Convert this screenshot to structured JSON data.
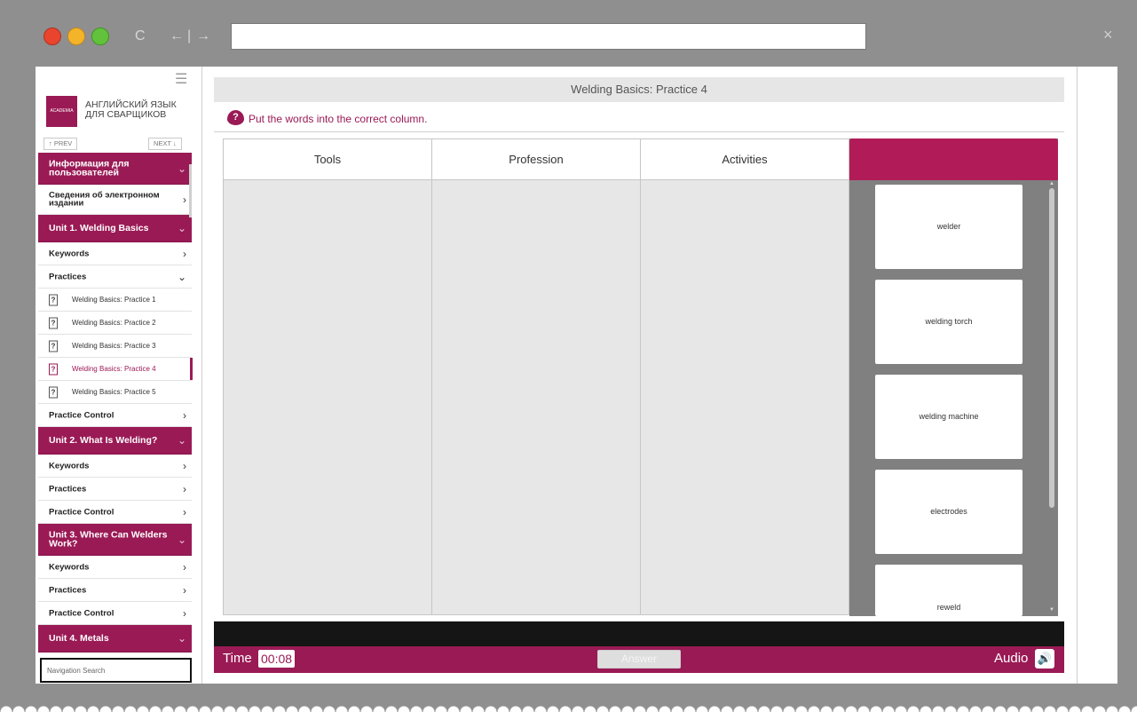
{
  "browser": {
    "refresh_icon": "C",
    "back_icon": "←",
    "forward_icon": "→",
    "divider": "|",
    "url": "",
    "close_icon": "×"
  },
  "sidebar": {
    "menu_icon": "☰",
    "logo_text": "ACADEMIA",
    "brand_line1": "АНГЛИЙСКИЙ ЯЗЫК",
    "brand_line2": "ДЛЯ СВАРЩИКОВ",
    "prev_label": "↑ PREV",
    "next_label": "NEXT ↓",
    "items": [
      {
        "type": "unit",
        "label": "Информация для пользователей",
        "chevron": "⌄"
      },
      {
        "type": "item",
        "label": "Сведения об электронном издании",
        "chevron": "›"
      },
      {
        "type": "unit",
        "label": "Unit 1. Welding Basics",
        "chevron": "⌄"
      },
      {
        "type": "item",
        "label": "Keywords",
        "chevron": "›"
      },
      {
        "type": "item",
        "label": "Practices",
        "chevron": "⌄"
      },
      {
        "type": "sub",
        "label": "Welding Basics: Practice 1",
        "icon": "?"
      },
      {
        "type": "sub",
        "label": "Welding Basics: Practice 2",
        "icon": "?"
      },
      {
        "type": "sub",
        "label": "Welding Basics: Practice 3",
        "icon": "?"
      },
      {
        "type": "sub",
        "label": "Welding Basics: Practice 4",
        "icon": "?",
        "active": true
      },
      {
        "type": "sub",
        "label": "Welding Basics: Practice 5",
        "icon": "?"
      },
      {
        "type": "item",
        "label": "Practice Control",
        "chevron": "›"
      },
      {
        "type": "unit",
        "label": "Unit 2. What Is Welding?",
        "chevron": "⌄"
      },
      {
        "type": "item",
        "label": "Keywords",
        "chevron": "›"
      },
      {
        "type": "item",
        "label": "Practices",
        "chevron": "›"
      },
      {
        "type": "item",
        "label": "Practice Control",
        "chevron": "›"
      },
      {
        "type": "unit",
        "label": "Unit 3. Where Can Welders Work?",
        "chevron": "⌄"
      },
      {
        "type": "item",
        "label": "Keywords",
        "chevron": "›"
      },
      {
        "type": "item",
        "label": "Practices",
        "chevron": "›"
      },
      {
        "type": "item",
        "label": "Practice Control",
        "chevron": "›"
      },
      {
        "type": "unit",
        "label": "Unit 4. Metals",
        "chevron": "⌄"
      }
    ],
    "search_placeholder": "Navigation Search"
  },
  "main": {
    "title": "Welding Basics: Practice 4",
    "instruction_icon": "?",
    "instruction": "Put the words into the correct column.",
    "columns": [
      "Tools",
      "Profession",
      "Activities"
    ],
    "word_bank": [
      "welder",
      "welding torch",
      "welding machine",
      "electrodes",
      "reweld"
    ],
    "scroll_up": "▲",
    "scroll_down": "▼"
  },
  "footer": {
    "time_label": "Time",
    "time_value": "00:08",
    "answer_label": "Answer",
    "audio_label": "Audio",
    "audio_icon": "🔊"
  },
  "colors": {
    "brand": "#9a1a55",
    "bank_header": "#b11c58",
    "bank_bg": "#808080"
  }
}
